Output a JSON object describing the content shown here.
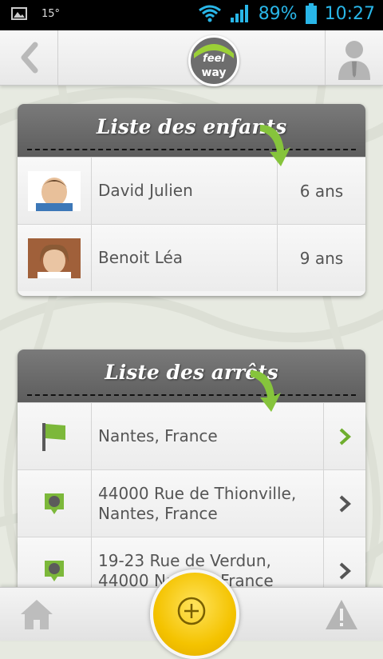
{
  "status_bar": {
    "temperature": "15°",
    "battery": "89%",
    "time": "10:27"
  },
  "header": {
    "logo_text_top": "feel",
    "logo_text_bottom": "way"
  },
  "children_card": {
    "title": "Liste des enfants",
    "items": [
      {
        "name": "David Julien",
        "age": "6 ans"
      },
      {
        "name": "Benoit Léa",
        "age": "9 ans"
      }
    ]
  },
  "stops_card": {
    "title": "Liste des arrêts",
    "items": [
      {
        "address": "Nantes, France",
        "icon": "flag-icon"
      },
      {
        "address": "44000 Rue de Thionville, Nantes, France",
        "icon": "feelway-pin-icon"
      },
      {
        "address": "19-23 Rue de Verdun, 44000 Nantes, France",
        "icon": "feelway-pin-icon"
      }
    ]
  },
  "colors": {
    "accent_green": "#7cb83a",
    "header_gray": "#6a6a6a",
    "status_blue": "#29b6e8",
    "add_button_yellow": "#f4c300"
  }
}
